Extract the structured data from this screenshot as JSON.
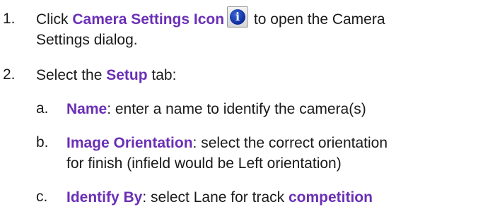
{
  "steps": [
    {
      "number": "1.",
      "pre": "Click ",
      "keyword": "Camera Settings Icon",
      "icon": "info-icon",
      "post": " to open the Camera",
      "continuation": "Settings dialog."
    },
    {
      "number": "2.",
      "pre": "Select the ",
      "keyword": "Setup",
      "post": " tab:"
    }
  ],
  "substeps": [
    {
      "letter": "a.",
      "keyword": "Name",
      "text": ": enter a name to identify the camera(s)"
    },
    {
      "letter": "b.",
      "keyword": "Image Orientation",
      "text": ": select the correct orientation",
      "continuation": "for finish (infield would be Left orientation)"
    },
    {
      "letter": "c.",
      "keyword": "Identify By",
      "text": ": select Lane for track ",
      "keyword2": "competition"
    }
  ],
  "colors": {
    "keyword": "#6a2fb5",
    "text": "#1a1a1a"
  }
}
